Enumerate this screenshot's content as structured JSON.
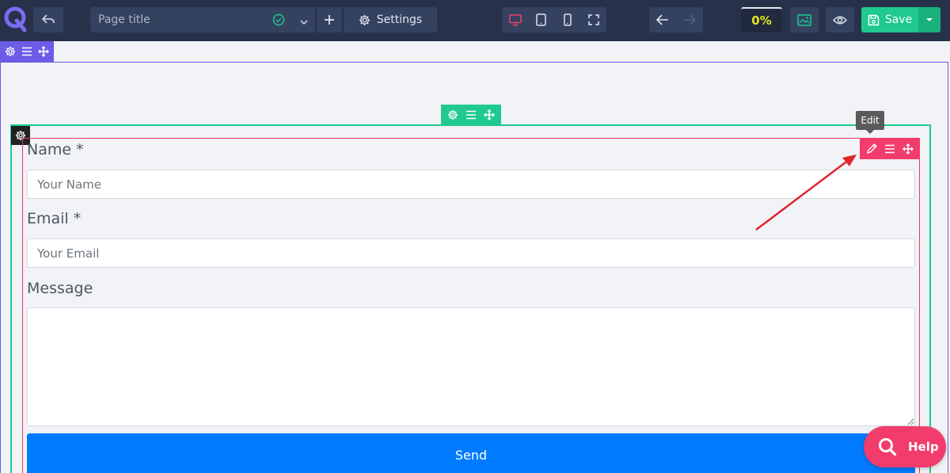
{
  "toolbar": {
    "page_title_placeholder": "Page title",
    "settings_label": "Settings",
    "progress": "0%",
    "save_label": "Save"
  },
  "tooltip": {
    "edit": "Edit"
  },
  "form": {
    "name_label": "Name *",
    "name_placeholder": "Your Name",
    "email_label": "Email *",
    "email_placeholder": "Your Email",
    "message_label": "Message",
    "send_label": "Send"
  },
  "help": {
    "label": "Help"
  },
  "colors": {
    "toolbar_bg": "#27324a",
    "section_outline": "#6c5ce7",
    "row_outline": "#1fc990",
    "element_outline": "#f23c6c",
    "send_button": "#007bff",
    "save_button": "#1fc990",
    "annotation_arrow": "#e0262b"
  }
}
